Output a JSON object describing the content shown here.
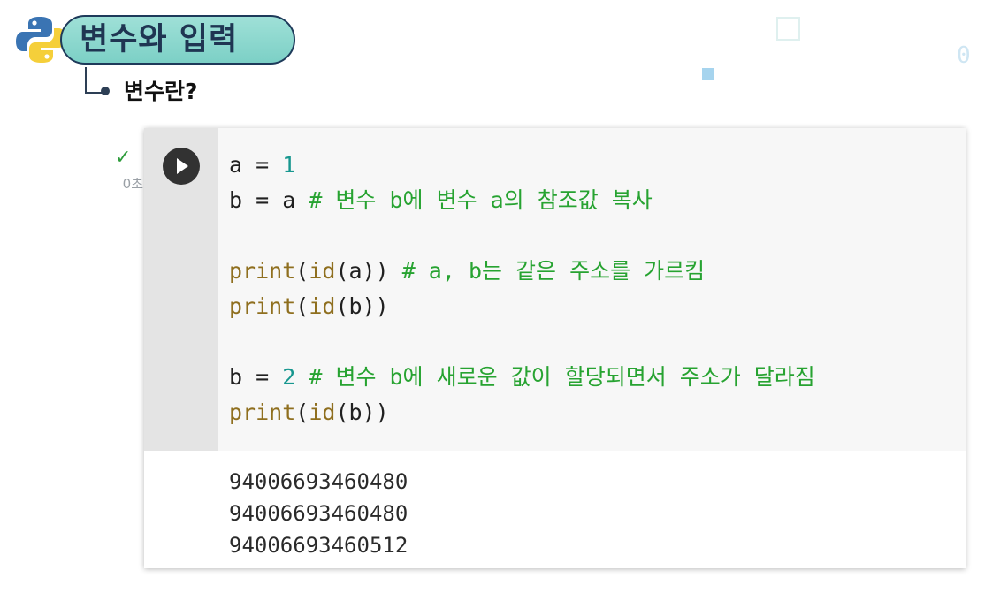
{
  "header": {
    "title": "변수와 입력",
    "subtitle": "변수란?"
  },
  "cell": {
    "status": "✓",
    "exec_time": "0초",
    "code": [
      [
        {
          "t": "a = ",
          "c": ""
        },
        {
          "t": "1",
          "c": "num"
        }
      ],
      [
        {
          "t": "b = a ",
          "c": ""
        },
        {
          "t": "# 변수 b에 변수 a의 참조값 복사",
          "c": "cmt"
        }
      ],
      [],
      [
        {
          "t": "print",
          "c": "fn"
        },
        {
          "t": "(",
          "c": ""
        },
        {
          "t": "id",
          "c": "fn"
        },
        {
          "t": "(a)) ",
          "c": ""
        },
        {
          "t": "# a, b는 같은 주소를 가르킴",
          "c": "cmt"
        }
      ],
      [
        {
          "t": "print",
          "c": "fn"
        },
        {
          "t": "(",
          "c": ""
        },
        {
          "t": "id",
          "c": "fn"
        },
        {
          "t": "(b))",
          "c": ""
        }
      ],
      [],
      [
        {
          "t": "b = ",
          "c": ""
        },
        {
          "t": "2",
          "c": "num"
        },
        {
          "t": " ",
          "c": ""
        },
        {
          "t": "# 변수 b에 새로운 값이 할당되면서 주소가 달라짐",
          "c": "cmt"
        }
      ],
      [
        {
          "t": "print",
          "c": "fn"
        },
        {
          "t": "(",
          "c": ""
        },
        {
          "t": "id",
          "c": "fn"
        },
        {
          "t": "(b))",
          "c": ""
        }
      ]
    ],
    "output": [
      "94006693460480",
      "94006693460480",
      "94006693460512"
    ]
  },
  "background": {
    "ghost_zero": "0"
  },
  "icons": {
    "logo": "python-logo-icon",
    "run": "play-icon",
    "status": "checkmark-icon"
  },
  "colors": {
    "badge": "#7cd0c6",
    "badge_border": "#1e3a5a",
    "comment": "#27a331",
    "number": "#17978f",
    "builtin": "#8f6f1f",
    "run_button": "#323232"
  }
}
